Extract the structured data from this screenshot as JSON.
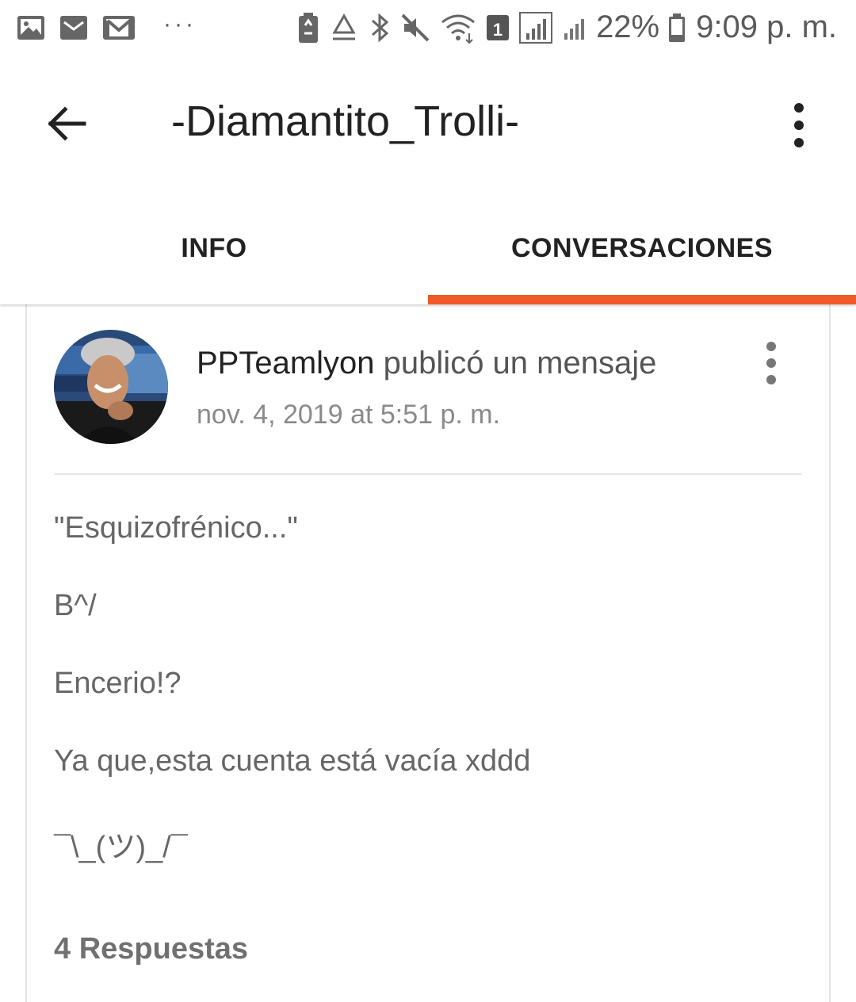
{
  "status_bar": {
    "battery_percent": "22%",
    "time": "9:09 p. m.",
    "notification_more": "···",
    "sim_slot": "1"
  },
  "app_bar": {
    "title": "-Diamantito_Trolli-"
  },
  "tabs": [
    {
      "label": "INFO",
      "selected": false
    },
    {
      "label": "CONVERSACIONES",
      "selected": true
    }
  ],
  "accent_color": "#f05a28",
  "post": {
    "author": "PPTeamlyon",
    "action": " publicó un mensaje",
    "date": "nov. 4, 2019 at 5:51 p. m.",
    "lines": [
      "\"Esquizofrénico...\"",
      "B^/",
      "Encerio!?",
      "Ya que,esta cuenta está vacía xddd",
      "¯\\_(ツ)_/¯"
    ],
    "replies": "4 Respuestas"
  }
}
